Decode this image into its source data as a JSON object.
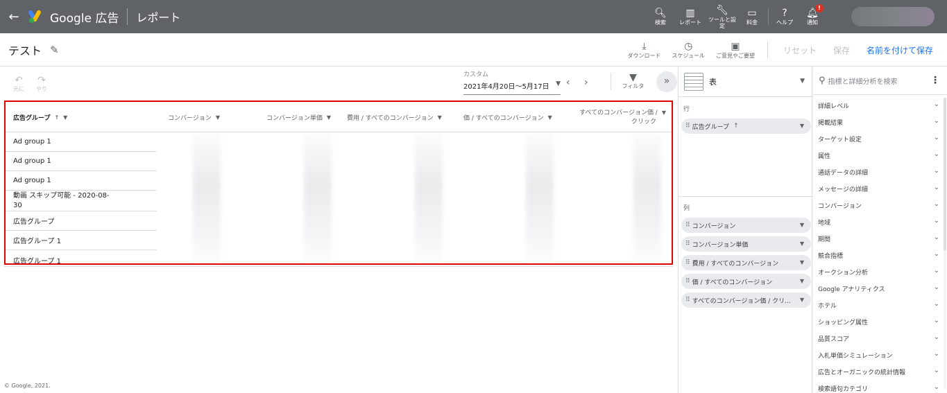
{
  "topbar": {
    "brand": "Google 広告",
    "page_name": "レポート",
    "actions": [
      {
        "label": "検索",
        "icon": "search-icon"
      },
      {
        "label": "レポート",
        "icon": "reports-icon"
      },
      {
        "label": "ツールと設定",
        "icon": "wrench-icon"
      },
      {
        "label": "料金",
        "icon": "billing-icon"
      },
      {
        "label": "ヘルプ",
        "icon": "help-icon"
      },
      {
        "label": "通知",
        "icon": "bell-icon"
      }
    ],
    "notification_badge": "!"
  },
  "subbar": {
    "report_title": "テスト",
    "download": "ダウンロード",
    "schedule": "スケジュール",
    "feedback": "ご意見やご要望",
    "reset": "リセット",
    "save": "保存",
    "save_as": "名前を付けて保存"
  },
  "toolbar": {
    "undo": "元に",
    "redo": "やり",
    "date_label": "カスタム",
    "date_range": "2021年4月20日～5月17日",
    "filter": "フィルタ"
  },
  "table": {
    "columns": [
      "広告グループ",
      "コンバージョン",
      "コンバージョン単価",
      "費用 / すべてのコンバージョン",
      "価 / すべてのコンバージョン",
      "すべてのコンバージョン価 /",
      "クリック"
    ],
    "rows": [
      "Ad group 1",
      "Ad group 1",
      "Ad group 1",
      "動画 スキップ可能 - 2020-08-",
      "30",
      "広告グループ",
      "広告グループ 1",
      "広告グループ 1"
    ]
  },
  "copyright": "© Google, 2021.",
  "mid_panel": {
    "viz": "表",
    "rows_label": "行",
    "row_chip": "広告グループ",
    "cols_label": "列",
    "col_chips": [
      "コンバージョン",
      "コンバージョン単価",
      "費用 / すべてのコンバージョン",
      "価 / すべてのコンバージョン",
      "すべてのコンバージョン価 / クリ..."
    ]
  },
  "right_panel": {
    "search_placeholder": "指標と詳細分析を検索",
    "items": [
      "詳細レベル",
      "掲載結果",
      "ターゲット設定",
      "属性",
      "通話データの詳細",
      "メッセージの詳細",
      "コンバージョン",
      "地域",
      "期間",
      "競合指標",
      "オークション分析",
      "Google アナリティクス",
      "ホテル",
      "ショッピング属性",
      "品質スコア",
      "入札単価シミュレーション",
      "広告とオーガニックの統計情報",
      "検索語句カテゴリ"
    ]
  },
  "colors": {
    "topbar_bg": "#5f6368",
    "highlight_border": "#e00000",
    "link_blue": "#1a73e8",
    "badge_red": "#d93025"
  }
}
